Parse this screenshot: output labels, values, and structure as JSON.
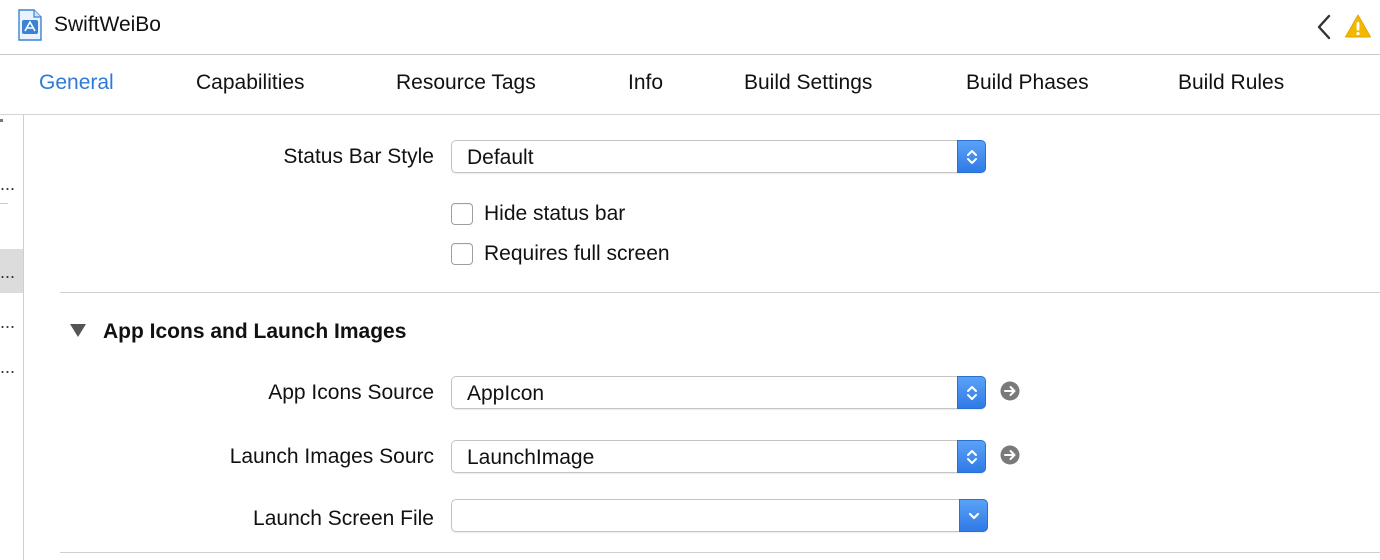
{
  "window": {
    "title": "SwiftWeiBo",
    "file_icon": "xcode-project-icon",
    "back_icon": "chevron-left-icon",
    "warning_icon": "warning-triangle-icon",
    "accent_color": "#2f7ad6",
    "warning_color": "#f5b800"
  },
  "tabs": [
    {
      "label": "General",
      "active": true
    },
    {
      "label": "Capabilities",
      "active": false
    },
    {
      "label": "Resource Tags",
      "active": false
    },
    {
      "label": "Info",
      "active": false
    },
    {
      "label": "Build Settings",
      "active": false
    },
    {
      "label": "Build Phases",
      "active": false
    },
    {
      "label": "Build Rules",
      "active": false
    }
  ],
  "left_strip": {
    "ellipsis": "..."
  },
  "deployment": {
    "status_bar_style": {
      "label": "Status Bar Style",
      "value": "Default"
    },
    "hide_status_bar": {
      "label": "Hide status bar",
      "checked": false
    },
    "requires_full_screen": {
      "label": "Requires full screen",
      "checked": false
    }
  },
  "app_icons_section": {
    "title": "App Icons and Launch Images",
    "disclosure_icon": "disclosure-triangle-down-icon",
    "app_icons_source": {
      "label": "App Icons Source",
      "value": "AppIcon"
    },
    "launch_images_source": {
      "label": "Launch Images Sourc",
      "value": "LaunchImage"
    },
    "launch_screen_file": {
      "label": "Launch Screen File",
      "value": ""
    },
    "go_icon": "arrow-right-circle-icon"
  }
}
